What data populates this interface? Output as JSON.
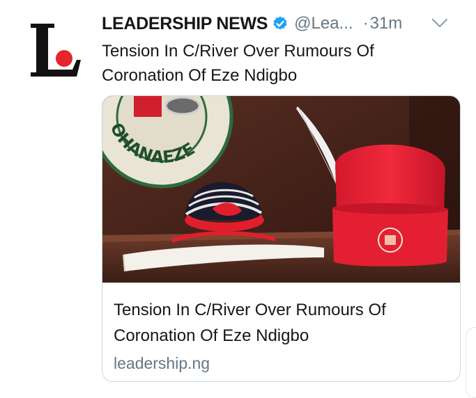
{
  "tweet": {
    "author_name": "LEADERSHIP NEWS",
    "handle": "@Lea...",
    "separator": "·",
    "time": "31m",
    "text": "Tension In C/River Over Rumours Of Coronation Of Eze Ndigbo",
    "avatar_letter": "L",
    "icons": [
      "verified-badge-icon",
      "chevron-down-icon"
    ]
  },
  "card": {
    "title": "Tension In C/River Over Rumours Of Coronation Of Eze Ndigbo",
    "domain": "leadership.ng",
    "image_text": "OHANAEZE"
  },
  "colors": {
    "verified_blue": "#1da1f2",
    "logo_red": "#e5252a",
    "text_primary": "#14171a",
    "text_secondary": "#657786",
    "border": "#ccd6dd"
  }
}
